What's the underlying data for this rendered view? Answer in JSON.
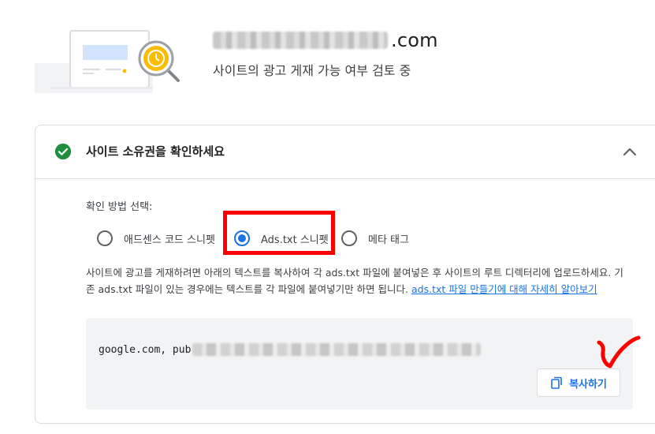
{
  "site": {
    "domain_visible_suffix": ".com",
    "status": "사이트의 광고 게재 가능 여부 검토 중"
  },
  "section": {
    "title": "사이트 소유권을 확인하세요",
    "method_label": "확인 방법 선택:",
    "options": [
      {
        "label": "애드센스 코드 스니펫",
        "selected": false
      },
      {
        "label": "Ads.txt 스니펫",
        "selected": true
      },
      {
        "label": "메타 태그",
        "selected": false
      }
    ],
    "description": "사이트에 광고를 게재하려면 아래의 텍스트를 복사하여 각 ads.txt 파일에 붙여넣은 후 사이트의 루트 디렉터리에 업로드하세요. 기존 ads.txt 파일이 있는 경우에는 텍스트를 각 파일에 붙여넣기만 하면 됩니다.",
    "learn_more_link": "ads.txt 파일 만들기에 대해 자세히 알아보기",
    "code_visible_prefix": "google.com, pub",
    "copy_button": "복사하기"
  },
  "icons": {
    "status": "check-circle-icon",
    "collapse": "chevron-up-icon",
    "copy": "copy-icon",
    "illustration": "site-review-illustration"
  },
  "colors": {
    "accent": "#1a73e8",
    "success": "#1e8e3e",
    "highlight": "#ff0000",
    "illustration_clock": "#fbbc04"
  }
}
